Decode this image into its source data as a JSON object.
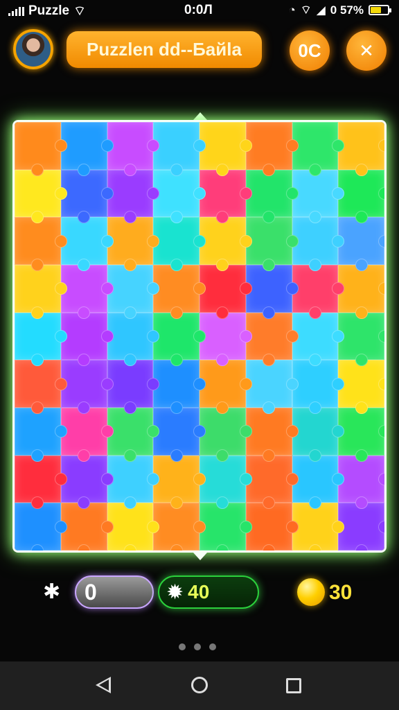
{
  "status_bar": {
    "app_label": "Puzzle",
    "time": "0:0Л",
    "battery_text": "0 57%",
    "battery_level": 0.57
  },
  "header": {
    "title": "Puzzlen dd--Байla",
    "left_button_label": "0C",
    "close_label": "✕"
  },
  "board": {
    "colors": [
      "#ff8a1c",
      "#1f9cff",
      "#c84cff",
      "#3ad0ff",
      "#ffd51a",
      "#ff7c22",
      "#2ee66a",
      "#ffc21a",
      "#ffe81f",
      "#3c69ff",
      "#9a3cff",
      "#3fe1ff",
      "#ff3d7a",
      "#22e46a",
      "#48d9ff",
      "#1ee858",
      "#ff8c1e",
      "#39d8ff",
      "#ffac1e",
      "#19e3d0",
      "#ffd21c",
      "#3ae06a",
      "#3ed0ff",
      "#4aa3ff",
      "#ffd21c",
      "#c84cff",
      "#46d3ff",
      "#ff8c22",
      "#ff2d3d",
      "#3d62ff",
      "#ff3f6a",
      "#ffb21a",
      "#23dcff",
      "#b43cff",
      "#2fc6ff",
      "#1ee66a",
      "#d960ff",
      "#ff7c2a",
      "#3ddcff",
      "#2ee46a",
      "#ff5a3a",
      "#9a3cff",
      "#7a3cff",
      "#1e8fff",
      "#ff9a1a",
      "#4ad4ff",
      "#2ecfff",
      "#ffe21a",
      "#1ea2ff",
      "#ff3ea8",
      "#3ae06a",
      "#2a7cff",
      "#3ddc6a",
      "#ff7a22",
      "#23d6d0",
      "#29e65a",
      "#ff2d3d",
      "#8a3cff",
      "#3ed0ff",
      "#ffb21a",
      "#26dcd8",
      "#ff6a2a",
      "#29c6ff",
      "#b44cff",
      "#1e90ff",
      "#ff7a22",
      "#ffe21a",
      "#ff8c22",
      "#27e46a",
      "#ff6a22",
      "#ffd21a",
      "#8a3cff"
    ]
  },
  "stats": {
    "puzzle_count": "0",
    "gear_count": "40",
    "coins": "30"
  },
  "pager": {
    "dots": 3
  }
}
